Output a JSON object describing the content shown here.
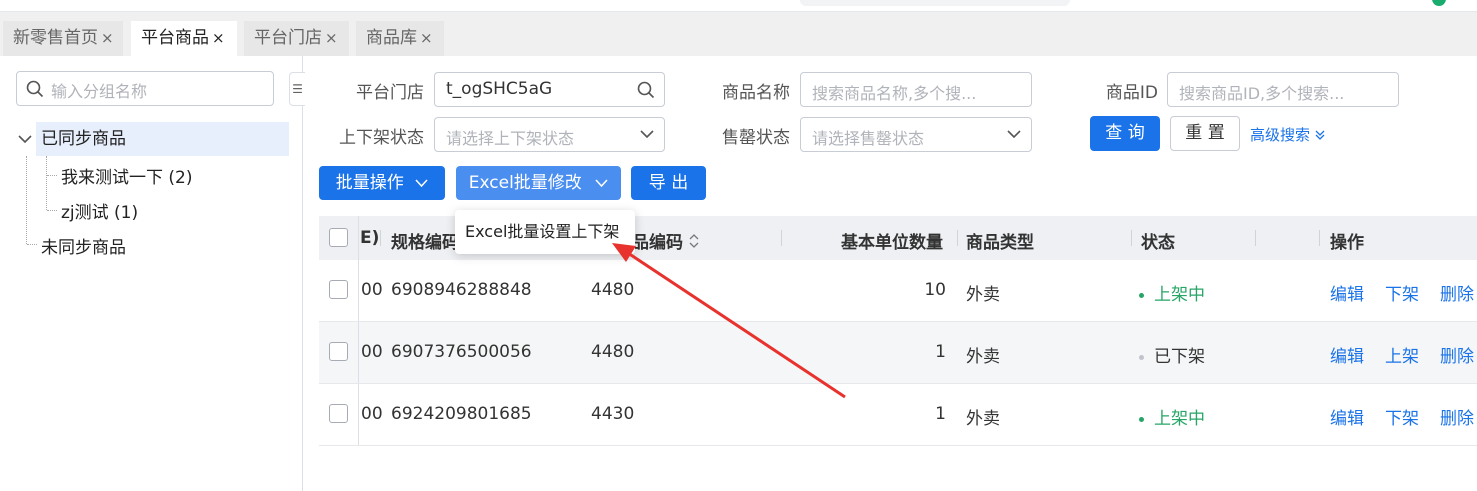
{
  "tabs": [
    {
      "label": "新零售首页",
      "close": "×",
      "active": false
    },
    {
      "label": "平台商品",
      "close": "×",
      "active": true
    },
    {
      "label": "平台门店",
      "close": "×",
      "active": false
    },
    {
      "label": "商品库",
      "close": "×",
      "active": false
    }
  ],
  "sidebar": {
    "search_placeholder": "输入分组名称",
    "collapse_glyph": "☰",
    "tree": {
      "synced": {
        "label": "已同步商品",
        "children": [
          {
            "label": "我来测试一下 (2)"
          },
          {
            "label": "zj测试 (1)"
          }
        ]
      },
      "unsynced": {
        "label": "未同步商品"
      }
    }
  },
  "filters": {
    "store": {
      "label": "平台门店",
      "value": "t_ogSHC5aG"
    },
    "product_name": {
      "label": "商品名称",
      "placeholder": "搜索商品名称,多个搜..."
    },
    "product_id": {
      "label": "商品ID",
      "placeholder": "搜索商品ID,多个搜索..."
    },
    "shelf_status": {
      "label": "上下架状态",
      "placeholder": "请选择上下架状态"
    },
    "sellout_status": {
      "label": "售罄状态",
      "placeholder": "请选择售罄状态"
    },
    "query_label": "查 询",
    "reset_label": "重 置",
    "advanced_label": "高级搜索"
  },
  "actions": {
    "batch_label": "批量操作",
    "excel_label": "Excel批量修改",
    "export_label": "导 出",
    "excel_menu": [
      "Excel批量设置上下架"
    ]
  },
  "table": {
    "partial_header": "E)",
    "columns": {
      "spec_code": "规格编码",
      "product_code": "商品编码",
      "unit_qty": "基本单位数量",
      "product_type": "商品类型",
      "status": "状态",
      "ops": "操作"
    },
    "rows": [
      {
        "partial": "00",
        "spec_code": "6908946288848",
        "product_code": "4480",
        "unit_qty": "10",
        "product_type": "外卖",
        "status": "上架中",
        "status_color": "#27a567",
        "ops": [
          "编辑",
          "下架",
          "删除"
        ]
      },
      {
        "partial": "00",
        "spec_code": "6907376500056",
        "product_code": "4480",
        "unit_qty": "1",
        "product_type": "外卖",
        "status": "已下架",
        "status_color": "#c0c4cc",
        "ops": [
          "编辑",
          "上架",
          "删除"
        ]
      },
      {
        "partial": "00",
        "spec_code": "6924209801685",
        "product_code": "4430",
        "unit_qty": "1",
        "product_type": "外卖",
        "status": "上架中",
        "status_color": "#27a567",
        "ops": [
          "编辑",
          "下架",
          "删除"
        ]
      }
    ]
  },
  "colors": {
    "accent": "#1a73e8",
    "annotation_arrow": "#e8322d",
    "active_status": "#27a567"
  }
}
